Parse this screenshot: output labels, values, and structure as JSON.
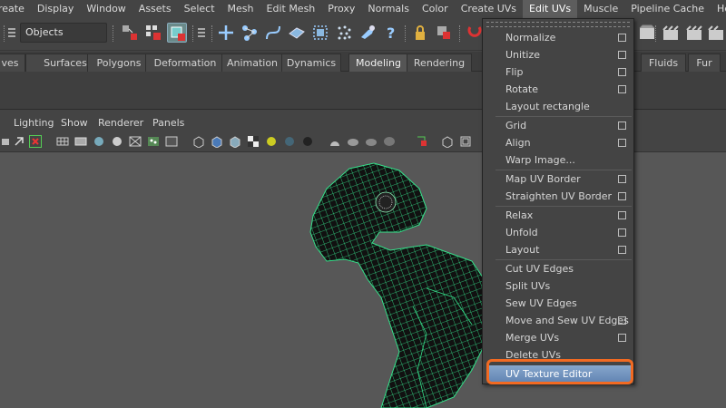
{
  "menubar": {
    "items": [
      "reate",
      "Display",
      "Window",
      "Assets",
      "Select",
      "Mesh",
      "Edit Mesh",
      "Proxy",
      "Normals",
      "Color",
      "Create UVs",
      "Edit UVs",
      "Muscle",
      "Pipeline Cache",
      "Help"
    ],
    "active_index": 11
  },
  "statusline": {
    "selection_mode": "Objects"
  },
  "shelf": {
    "tabs": [
      "ves",
      "Surfaces",
      "Polygons",
      "Deformation",
      "Animation",
      "Dynamics",
      "Modeling",
      "Rendering",
      "Fluids",
      "Fur"
    ],
    "active_tab": "Modeling"
  },
  "panel": {
    "menus": [
      "Lighting",
      "Show",
      "Renderer",
      "Panels"
    ]
  },
  "edit_uvs_menu": {
    "groups": [
      [
        {
          "label": "Normalize",
          "option_box": true
        },
        {
          "label": "Unitize",
          "option_box": true
        },
        {
          "label": "Flip",
          "option_box": true
        },
        {
          "label": "Rotate",
          "option_box": true
        },
        {
          "label": "Layout rectangle",
          "option_box": false
        }
      ],
      [
        {
          "label": "Grid",
          "option_box": true
        },
        {
          "label": "Align",
          "option_box": true
        },
        {
          "label": "Warp Image...",
          "option_box": false
        }
      ],
      [
        {
          "label": "Map UV Border",
          "option_box": true
        },
        {
          "label": "Straighten UV Border",
          "option_box": true
        }
      ],
      [
        {
          "label": "Relax",
          "option_box": true
        },
        {
          "label": "Unfold",
          "option_box": true
        },
        {
          "label": "Layout",
          "option_box": true
        }
      ],
      [
        {
          "label": "Cut UV Edges",
          "option_box": false
        },
        {
          "label": "Split UVs",
          "option_box": false
        },
        {
          "label": "Sew UV Edges",
          "option_box": false
        },
        {
          "label": "Move and Sew UV Edges",
          "option_box": true
        },
        {
          "label": "Merge UVs",
          "option_box": true
        },
        {
          "label": "Delete UVs",
          "option_box": false
        },
        {
          "label": "UV Texture Editor",
          "option_box": false
        }
      ]
    ],
    "highlighted_item": "UV Texture Editor"
  },
  "colors": {
    "highlight": "#7096c4",
    "callout": "#f26a22",
    "wireframe": "#35e08a"
  }
}
